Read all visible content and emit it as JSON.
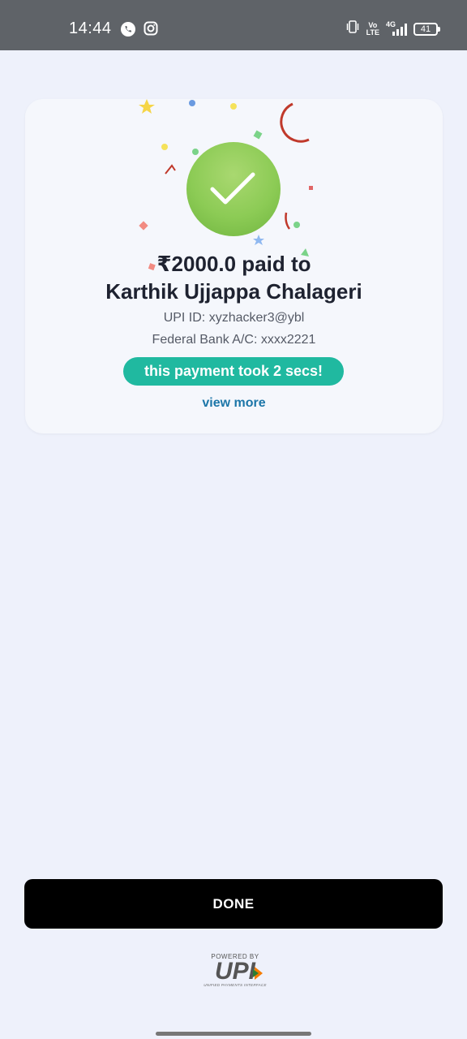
{
  "status_bar": {
    "time": "14:44",
    "icons": [
      "whatsapp-icon",
      "instagram-icon",
      "vibrate-icon",
      "volte-icon",
      "signal-icon"
    ],
    "network": {
      "line1": "Vo",
      "line2": "LTE",
      "type": "4G"
    },
    "battery": "41"
  },
  "payment": {
    "amount_line": "₹2000.0 paid to",
    "payee_name": "Karthik Ujjappa Chalageri",
    "upi_id": "UPI ID: xyzhacker3@ybl",
    "bank": "Federal Bank A/C: xxxx2221",
    "speed_badge": "this payment took 2 secs!",
    "view_more": "view more"
  },
  "actions": {
    "done_label": "DONE"
  },
  "footer": {
    "powered_by": "POWERED BY",
    "logo_text": "UPI",
    "logo_subtitle": "UNIFIED PAYMENTS INTERFACE"
  },
  "colors": {
    "success_green": "#8ccb55",
    "badge_teal": "#20b9a0",
    "link_blue": "#1c76a8",
    "page_bg": "#eef1fb"
  }
}
